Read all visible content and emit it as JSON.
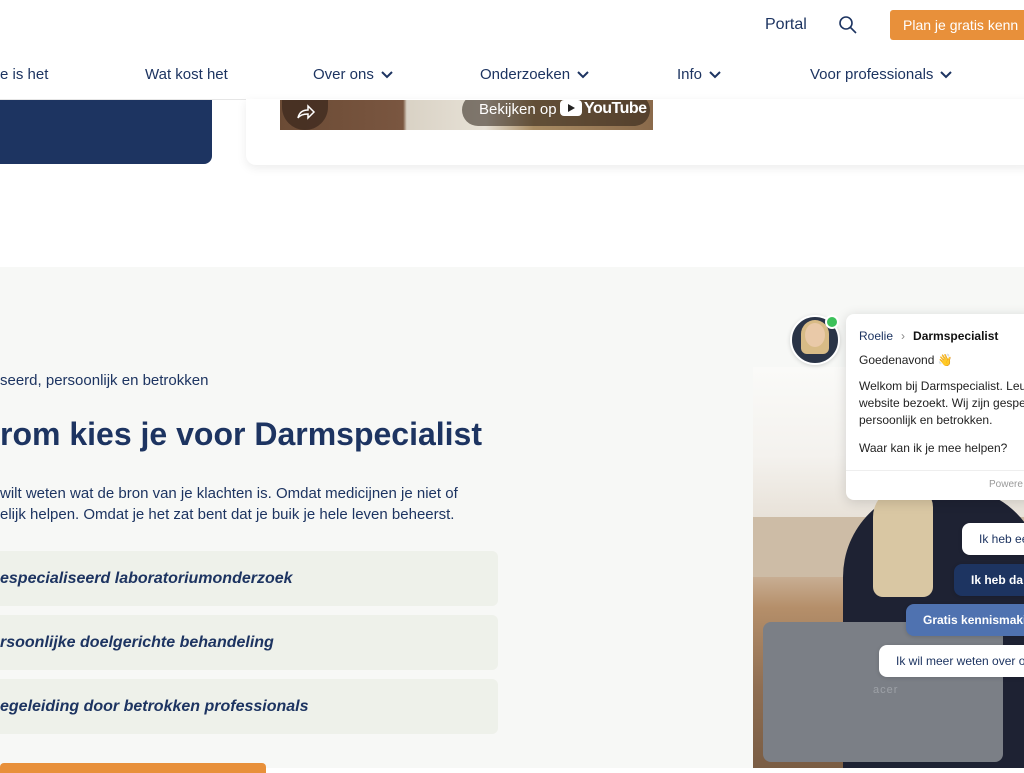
{
  "header": {
    "portal_label": "Portal",
    "cta_label": "Plan je gratis kenn"
  },
  "nav": {
    "items": [
      {
        "label": "e is het"
      },
      {
        "label": "Wat kost het"
      },
      {
        "label": "Over ons"
      },
      {
        "label": "Onderzoeken"
      },
      {
        "label": "Info"
      },
      {
        "label": "Voor professionals"
      }
    ]
  },
  "video": {
    "watch_label": "Bekijken op",
    "brand_label": "YouTube"
  },
  "section": {
    "eyebrow": "seerd, persoonlijk en betrokken",
    "heading": "rom kies je voor Darmspecialist",
    "paragraph_line1": "wilt weten wat de bron van je klachten is. Omdat medicijnen je niet of",
    "paragraph_line2": "elijk helpen. Omdat je het zat bent dat je buik je hele leven beheerst.",
    "features": [
      "especialiseerd laboratoriumonderzoek",
      "rsoonlijke doelgerichte behandeling",
      "egeleiding door betrokken professionals"
    ]
  },
  "chat": {
    "agent_name": "Roelie",
    "separator": "›",
    "company": "Darmspecialist",
    "greeting": "Goedenavond 👋",
    "message": "Welkom bij Darmspecialist. Leul website bezoekt. Wij zijn gespe persoonlijk en betrokken.",
    "question": "Waar kan ik je mee helpen?",
    "powered": "Powere",
    "quick_replies": [
      {
        "label": "Ik heb ee",
        "style": "light"
      },
      {
        "label": "Ik heb da",
        "style": "dark"
      },
      {
        "label": "Gratis kennismaki",
        "style": "mid"
      },
      {
        "label": "Ik wil meer weten over o",
        "style": "light"
      }
    ]
  },
  "photo": {
    "laptop_brand": "acer"
  },
  "colors": {
    "navy": "#1d3461",
    "orange": "#e8903a",
    "section_bg": "#f7f8f6",
    "feature_bg": "#eef1ea",
    "online": "#3cc15a"
  }
}
